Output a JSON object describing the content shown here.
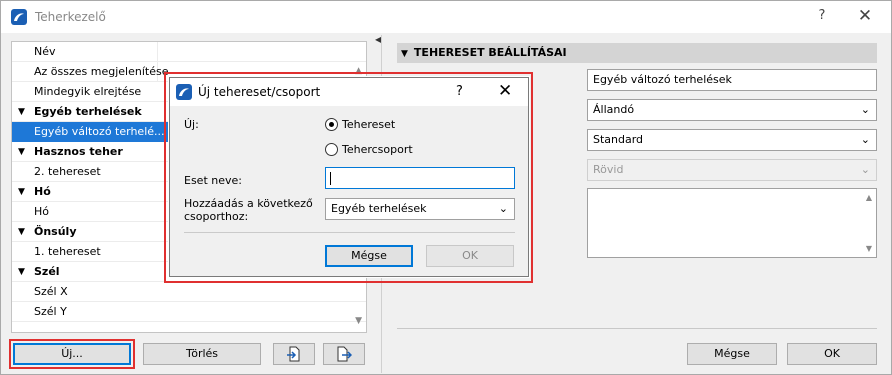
{
  "window": {
    "title": "Teherkezelő",
    "help": "?",
    "close": "✕"
  },
  "list": {
    "rows": [
      {
        "label": "Név",
        "type": "item"
      },
      {
        "label": "Az összes megjelenítése",
        "type": "item"
      },
      {
        "label": "Mindegyik elrejtése",
        "type": "item"
      },
      {
        "label": "Egyéb terhelések",
        "type": "header"
      },
      {
        "label": "Egyéb változó terhelé...",
        "type": "selected"
      },
      {
        "label": "Hasznos teher",
        "type": "header"
      },
      {
        "label": "2. tehereset",
        "type": "item"
      },
      {
        "label": "Hó",
        "type": "header"
      },
      {
        "label": "Hó",
        "type": "item"
      },
      {
        "label": "Önsúly",
        "type": "header"
      },
      {
        "label": "1. tehereset",
        "type": "item"
      },
      {
        "label": "Szél",
        "type": "header"
      },
      {
        "label": "Szél X",
        "type": "item"
      },
      {
        "label": "Szél Y",
        "type": "item"
      }
    ]
  },
  "left_buttons": {
    "new": "Új...",
    "delete": "Törlés"
  },
  "settings": {
    "header": "TEHERESET BEÁLLÍTÁSAI",
    "name_value": "Egyéb változó terhelések",
    "duration_value": "Állandó",
    "type_value": "Standard",
    "short_placeholder": "Rövid"
  },
  "bottom_buttons": {
    "cancel": "Mégse",
    "ok": "OK"
  },
  "modal": {
    "title": "Új tehereset/csoport",
    "help": "?",
    "close": "✕",
    "new_label": "Új:",
    "radio_case": "Tehereset",
    "radio_group": "Tehercsoport",
    "case_name_label": "Eset neve:",
    "add_to_label_line1": "Hozzáadás a következő",
    "add_to_label_line2": "csoporthoz:",
    "group_select_value": "Egyéb terhelések",
    "cancel": "Mégse",
    "ok": "OK"
  },
  "colors": {
    "selection": "#1e78d7",
    "highlight_box": "#e03030",
    "focus": "#0078d7"
  }
}
